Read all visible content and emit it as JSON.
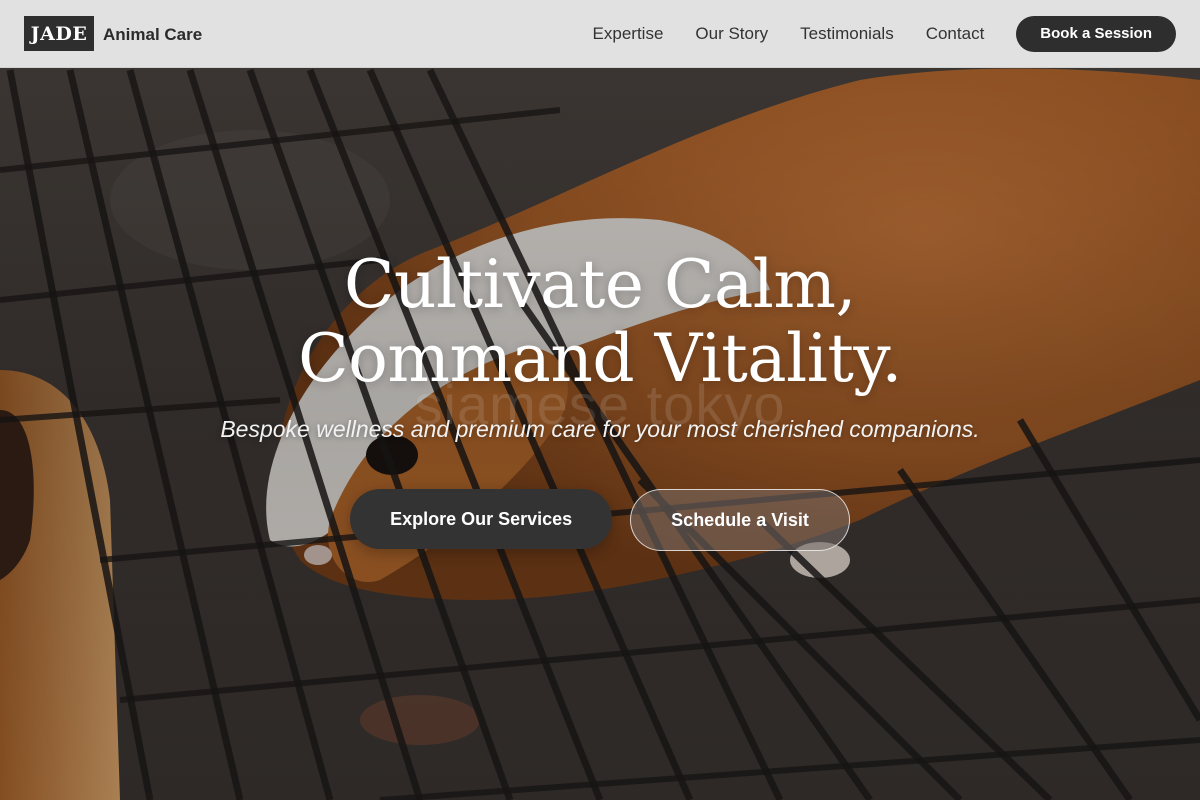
{
  "header": {
    "logo_mark": "JADE",
    "logo_text": "Animal Care",
    "nav": [
      "Expertise",
      "Our Story",
      "Testimonials",
      "Contact"
    ],
    "cta_label": "Book a Session"
  },
  "hero": {
    "title_line1": "Cultivate Calm,",
    "title_line2": "Command Vitality.",
    "watermark": "siamese tokyo",
    "subtitle": "Bespoke wellness and premium care for your most cherished companions.",
    "primary_button": "Explore Our Services",
    "secondary_button": "Schedule a Visit"
  },
  "colors": {
    "header_bg": "#ececec",
    "dark": "#2e2e2e",
    "fur_orange": "#b0652a",
    "fur_white": "#e8e4df"
  },
  "images": {
    "hero_background": "guinea pig on wire cage grid"
  }
}
